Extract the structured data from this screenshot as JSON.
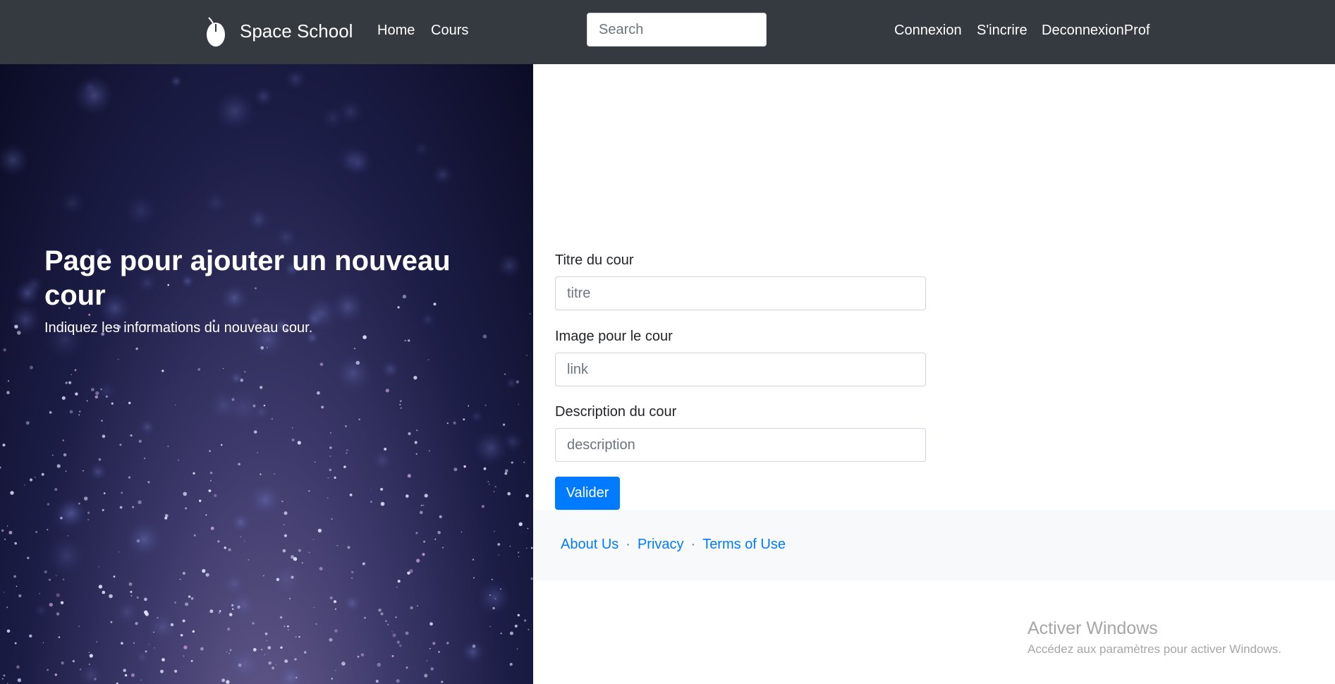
{
  "navbar": {
    "brand": "Space School",
    "brand_icon": "mouse-icon",
    "links": [
      "Home",
      "Cours"
    ],
    "search_placeholder": "Search",
    "right_links": [
      "Connexion",
      "S'incrire",
      "DeconnexionProf"
    ],
    "background": "#343a40"
  },
  "hero": {
    "title": "Page pour ajouter un nouveau cour",
    "subtitle": "Indiquez les informations du nouveau cour."
  },
  "form": {
    "title_label": "Titre du cour",
    "title_placeholder": "titre",
    "title_value": "",
    "image_label": "Image pour le cour",
    "image_placeholder": "link",
    "image_value": "",
    "description_label": "Description du cour",
    "description_placeholder": "description",
    "description_value": "",
    "submit": "Valider",
    "accent": "#007bff"
  },
  "footer": {
    "links": [
      "About Us",
      "Privacy",
      "Terms of Use"
    ],
    "separator": "·"
  },
  "watermark": {
    "title": "Activer Windows",
    "subtitle": "Accédez aux paramètres pour activer Windows."
  }
}
